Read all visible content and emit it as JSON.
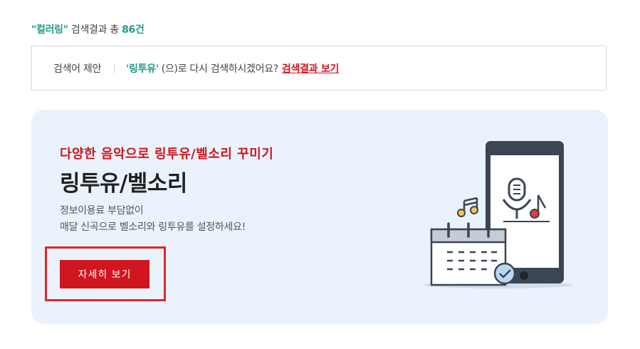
{
  "result_header": {
    "keyword": "\"컬러링\"",
    "text_mid": " 검색결과 총 ",
    "count": "86건"
  },
  "suggestion": {
    "label": "검색어 제안",
    "term": "'링투유'",
    "question": "(으)로 다시 검색하시겠어요?",
    "link": "검색결과 보기"
  },
  "banner": {
    "subtitle": "다양한 음악으로 링투유/벨소리 꾸미기",
    "title": "링투유/벨소리",
    "desc_line1": "정보이용료 부담없이",
    "desc_line2": "매달 신곡으로 벨소리와 링투유를 설정하세요!",
    "button": "자세히 보기"
  },
  "colors": {
    "accent_red": "#d0161e",
    "teal": "#1f9a8a",
    "banner_bg": "#eaf3fb"
  },
  "icons": [
    "music-note-icon",
    "microphone-icon",
    "calendar-icon",
    "check-icon",
    "smartphone-icon"
  ]
}
